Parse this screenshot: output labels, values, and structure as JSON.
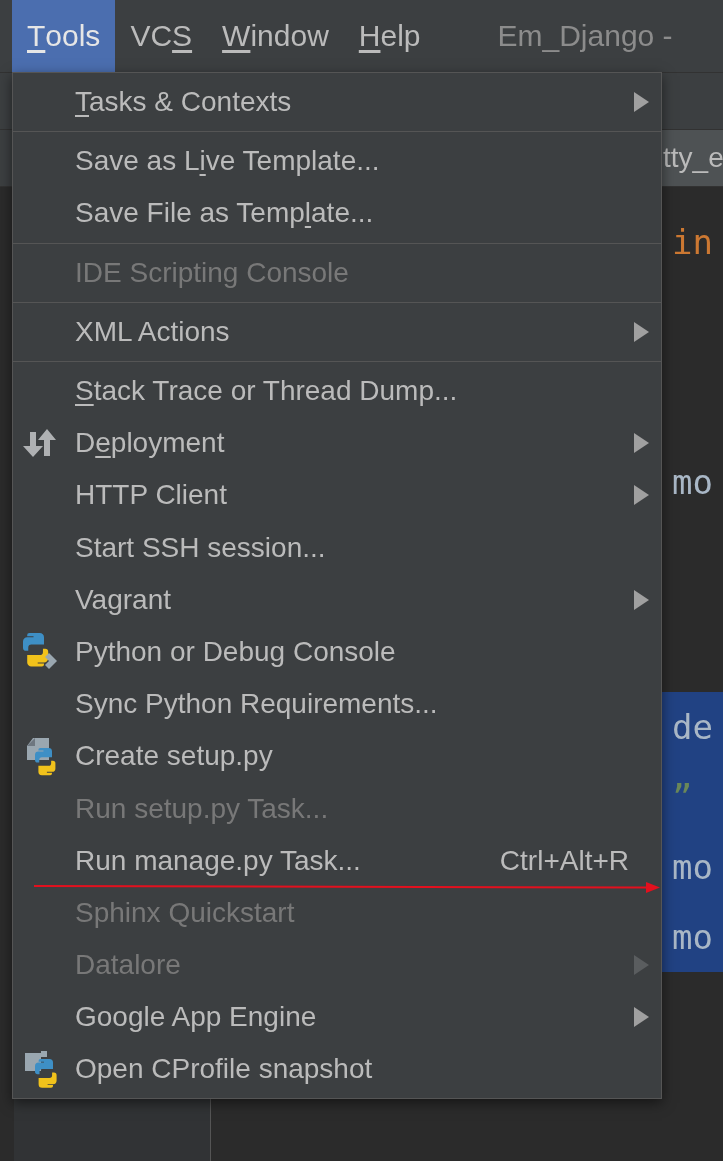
{
  "menu_bar": {
    "items": [
      {
        "parts": [
          {
            "text": "T",
            "underline": true
          },
          {
            "text": "ools",
            "underline": false
          }
        ],
        "selected": true
      },
      {
        "parts": [
          {
            "text": "VC",
            "underline": false
          },
          {
            "text": "S",
            "underline": true
          }
        ],
        "selected": false
      },
      {
        "parts": [
          {
            "text": "W",
            "underline": true
          },
          {
            "text": "indow",
            "underline": false
          }
        ],
        "selected": false
      },
      {
        "parts": [
          {
            "text": "H",
            "underline": true
          },
          {
            "text": "elp",
            "underline": false
          }
        ],
        "selected": false
      }
    ],
    "title": "Em_Django -"
  },
  "editor": {
    "tab": "tty_e",
    "lines": [
      {
        "text": "in",
        "kind": "keyword",
        "selected": false
      },
      {
        "text": "mo",
        "kind": "code",
        "selected": false
      },
      {
        "text": "de",
        "kind": "code",
        "selected": true
      },
      {
        "text": "”",
        "kind": "string",
        "selected": true
      },
      {
        "text": "mo",
        "kind": "code",
        "selected": true
      },
      {
        "text": "mo",
        "kind": "code",
        "selected": true
      }
    ]
  },
  "menu": {
    "groups": [
      [
        {
          "parts": [
            {
              "text": "T",
              "underline": true
            },
            {
              "text": "asks & Contexts",
              "underline": false
            }
          ],
          "kind": "submenu",
          "disabled": false
        }
      ],
      [
        {
          "parts": [
            {
              "text": "Save as L",
              "underline": false
            },
            {
              "text": "i",
              "underline": true
            },
            {
              "text": "ve Template...",
              "underline": false
            }
          ],
          "kind": "action",
          "disabled": false
        },
        {
          "parts": [
            {
              "text": "Save File as Temp",
              "underline": false
            },
            {
              "text": "l",
              "underline": true
            },
            {
              "text": "ate...",
              "underline": false
            }
          ],
          "kind": "action",
          "disabled": false
        }
      ],
      [
        {
          "parts": [
            {
              "text": "IDE Scripting Console",
              "underline": false
            }
          ],
          "kind": "action",
          "disabled": true
        }
      ],
      [
        {
          "parts": [
            {
              "text": "XML Actions",
              "underline": false
            }
          ],
          "kind": "submenu",
          "disabled": false
        }
      ],
      [
        {
          "parts": [
            {
              "text": "S",
              "underline": true
            },
            {
              "text": "tack Trace or Thread Dump...",
              "underline": false
            }
          ],
          "kind": "action",
          "disabled": false
        },
        {
          "parts": [
            {
              "text": "D",
              "underline": false
            },
            {
              "text": "e",
              "underline": true
            },
            {
              "text": "ployment",
              "underline": false
            }
          ],
          "kind": "deployment",
          "disabled": false
        },
        {
          "parts": [
            {
              "text": "HTTP Client",
              "underline": false
            }
          ],
          "kind": "submenu",
          "disabled": false
        },
        {
          "parts": [
            {
              "text": "Start SSH session...",
              "underline": false
            }
          ],
          "kind": "action",
          "disabled": false
        },
        {
          "parts": [
            {
              "text": "Vagrant",
              "underline": false
            }
          ],
          "kind": "submenu",
          "disabled": false
        },
        {
          "parts": [
            {
              "text": "Python or Debug Console",
              "underline": false
            }
          ],
          "kind": "console",
          "disabled": false
        },
        {
          "parts": [
            {
              "text": "Sync Python Requirements...",
              "underline": false
            }
          ],
          "kind": "action",
          "disabled": false
        },
        {
          "parts": [
            {
              "text": "Create setup.py",
              "underline": false
            }
          ],
          "kind": "setup",
          "disabled": false
        },
        {
          "parts": [
            {
              "text": "Run setup.py Task...",
              "underline": false
            }
          ],
          "kind": "action",
          "disabled": true
        },
        {
          "parts": [
            {
              "text": "Run manage.py Task...",
              "underline": false
            }
          ],
          "kind": "shortcut",
          "disabled": false,
          "shortcut": "Ctrl+Alt+R"
        },
        {
          "parts": [
            {
              "text": "Sphinx Quickstart",
              "underline": false
            }
          ],
          "kind": "action",
          "disabled": true
        },
        {
          "parts": [
            {
              "text": "Datalore",
              "underline": false
            }
          ],
          "kind": "submenu",
          "disabled": true
        },
        {
          "parts": [
            {
              "text": "Google App Engine",
              "underline": false
            }
          ],
          "kind": "submenu",
          "disabled": false
        },
        {
          "parts": [
            {
              "text": "Open CProfile snapshot",
              "underline": false
            }
          ],
          "kind": "profile",
          "disabled": false
        }
      ]
    ]
  },
  "annotation": {
    "kind": "arrow"
  }
}
